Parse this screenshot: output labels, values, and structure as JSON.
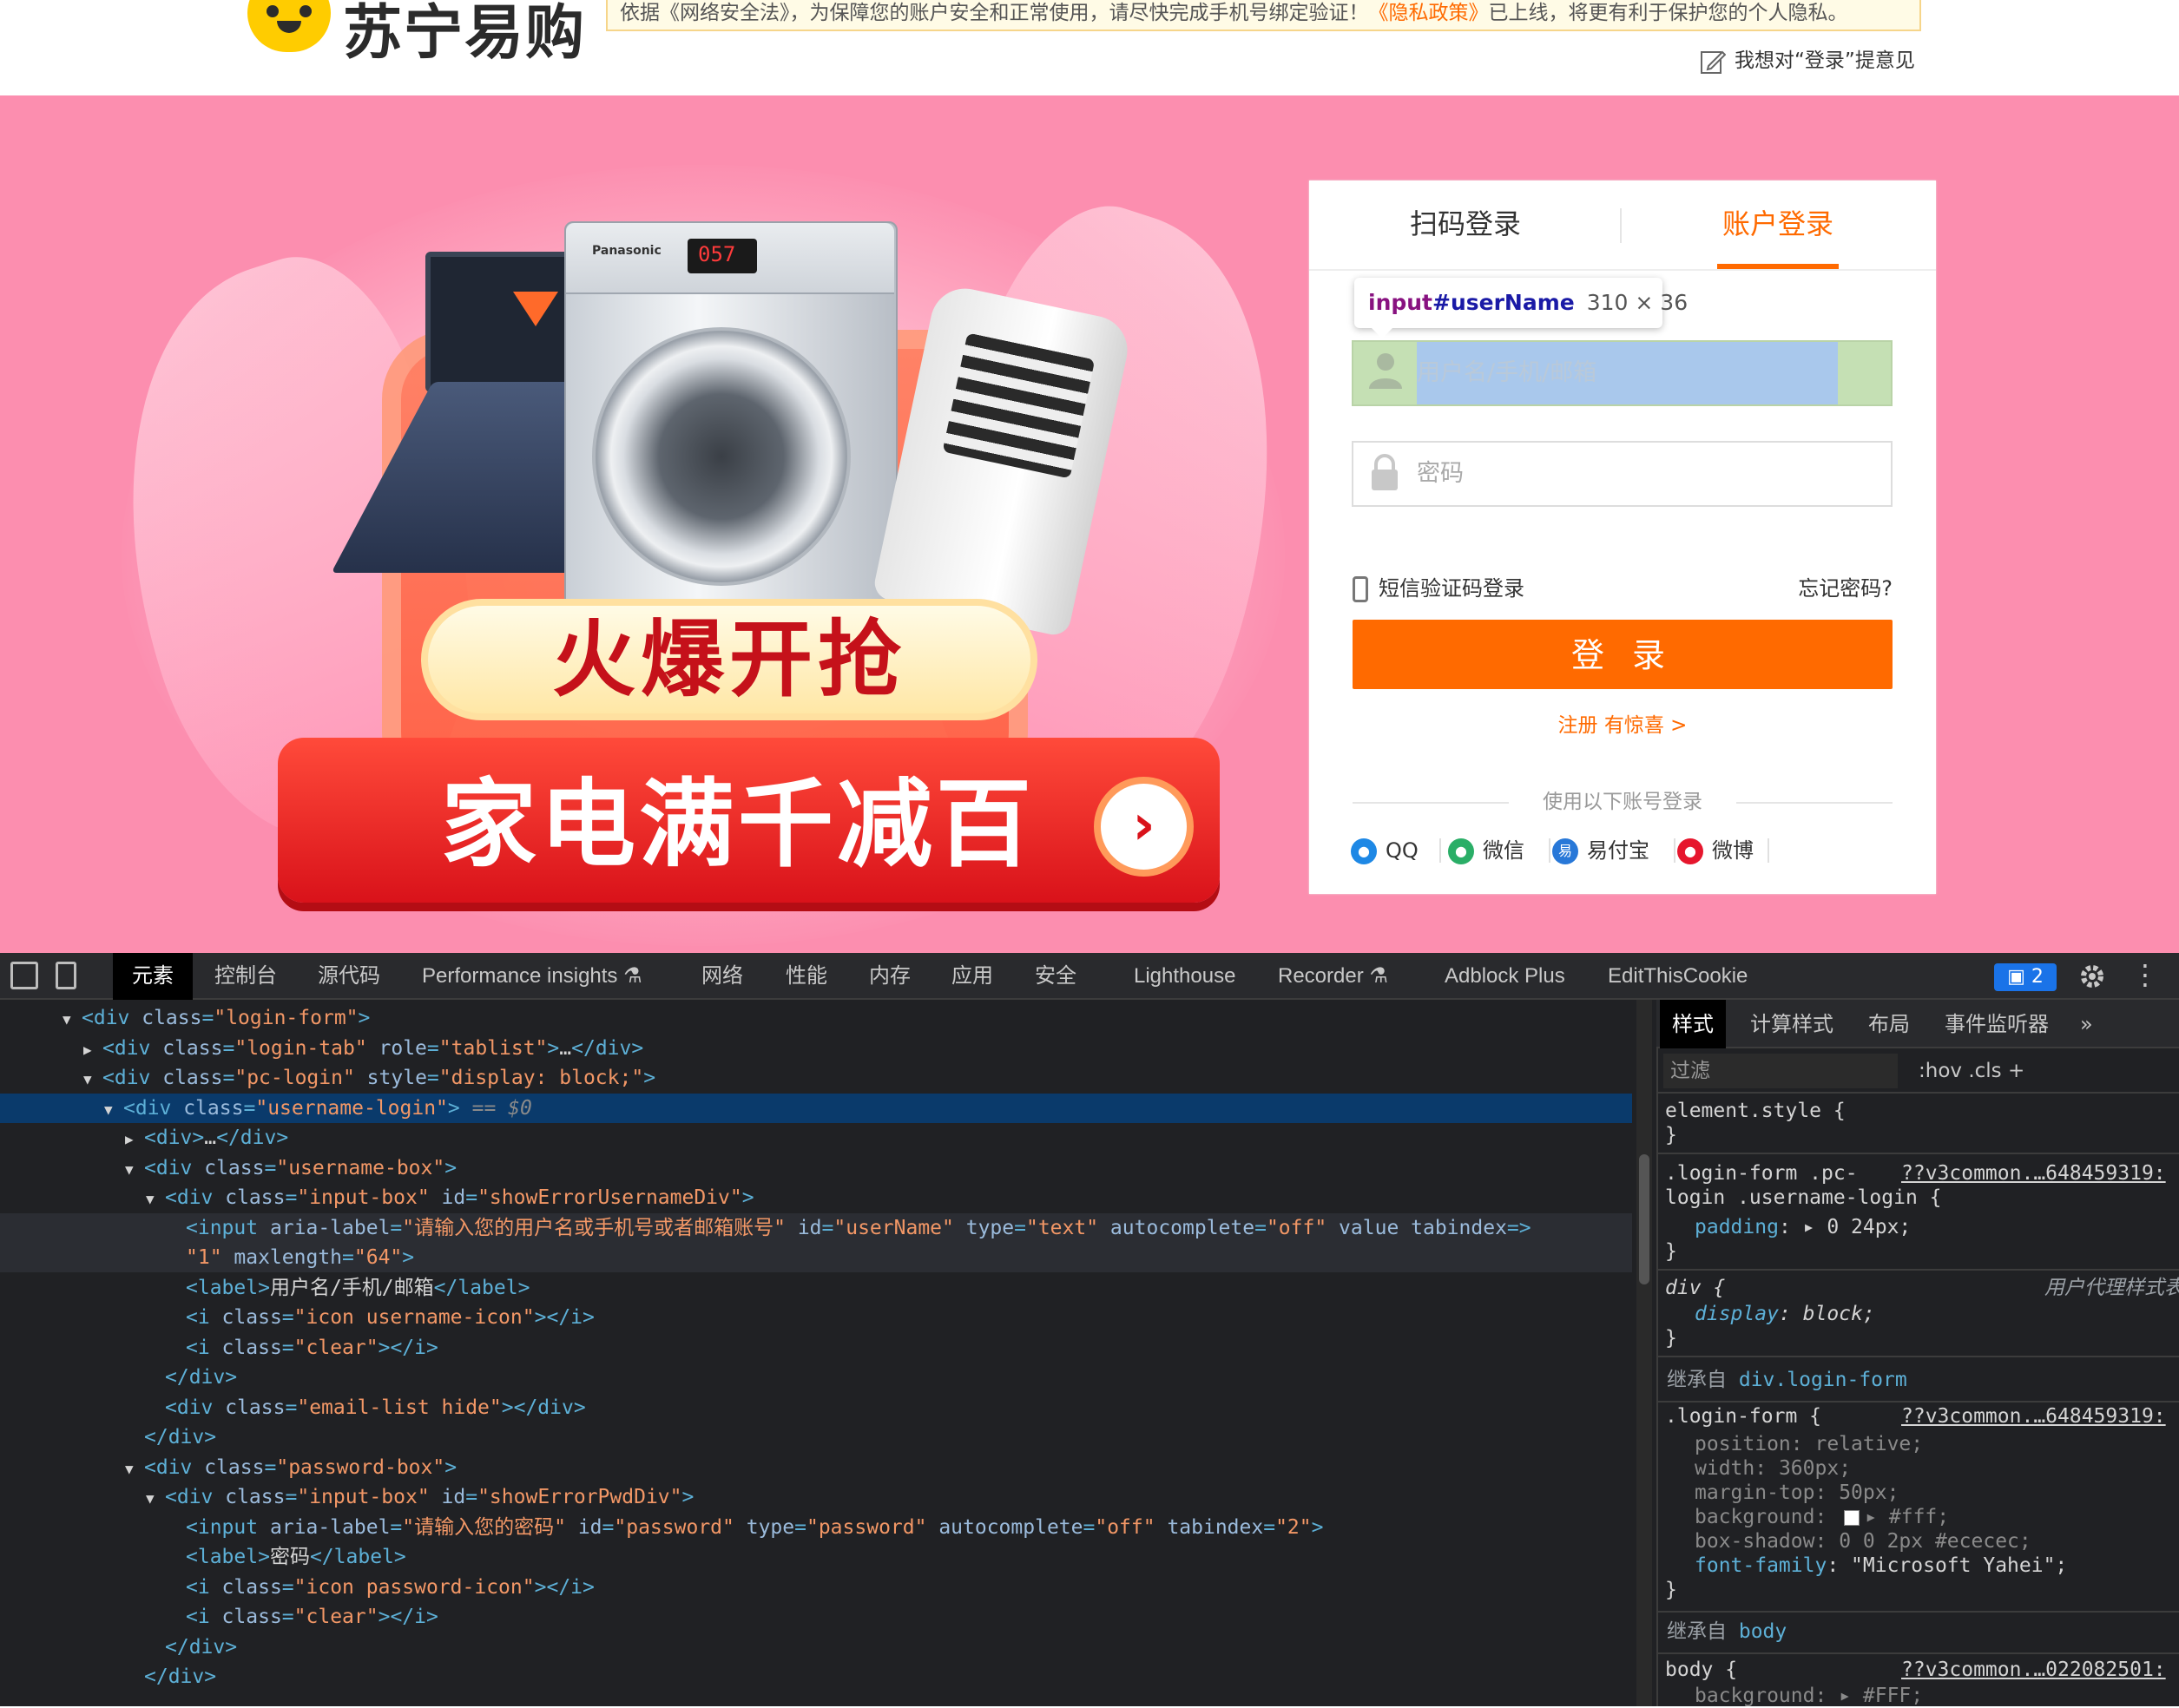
{
  "header": {
    "logo_text": "苏宁易购",
    "notice_prefix": "依据《网络安全法》，为保障您的账户安全和正常使用，请尽快完成手机号绑定验证！",
    "notice_link": "《隐私政策》",
    "notice_suffix": "已上线，将更有利于保护您的个人隐私。",
    "feedback": "我想对“登录”提意见"
  },
  "banner": {
    "slogan_top": "火爆开抢",
    "slogan_bottom": "家电满千减百",
    "washer_brand": "Panasonic"
  },
  "login": {
    "tab_qr": "扫码登录",
    "tab_account": "账户登录",
    "tooltip_tag": "input",
    "tooltip_id": "#userName",
    "tooltip_dim": "310 × 36",
    "username_placeholder": "用户名/手机/邮箱",
    "password_placeholder": "密码",
    "sms_login": "短信验证码登录",
    "forgot": "忘记密码?",
    "submit": "登 录",
    "register": "注册 有惊喜 >",
    "third_title": "使用以下账号登录",
    "third_party": [
      {
        "label": "QQ",
        "color": "#1e88e5"
      },
      {
        "label": "微信",
        "color": "#2aae67"
      },
      {
        "label": "易付宝",
        "color": "#2878d8"
      },
      {
        "label": "微博",
        "color": "#e6162d"
      }
    ]
  },
  "devtools": {
    "tabs": [
      "元素",
      "控制台",
      "源代码",
      "Performance insights",
      "网络",
      "性能",
      "内存",
      "应用",
      "安全",
      "Lighthouse",
      "Recorder",
      "Adblock Plus",
      "EditThisCookie"
    ],
    "issues_count": "2",
    "dom": [
      {
        "indent": 0,
        "tri": "▼",
        "html": "div",
        "attrs": [
          [
            "class",
            "login-form"
          ]
        ],
        "close": false
      },
      {
        "indent": 1,
        "tri": "▶",
        "html": "div",
        "attrs": [
          [
            "class",
            "login-tab"
          ],
          [
            "role",
            "tablist"
          ]
        ],
        "close": true,
        "inner": "…"
      },
      {
        "indent": 1,
        "tri": "▼",
        "html": "div",
        "attrs": [
          [
            "class",
            "pc-login"
          ],
          [
            "style",
            "display: block;"
          ]
        ],
        "close": false
      },
      {
        "indent": 2,
        "tri": "▼",
        "html": "div",
        "attrs": [
          [
            "class",
            "username-login"
          ]
        ],
        "close": false,
        "selected": true,
        "suffix": " == $0"
      },
      {
        "indent": 3,
        "tri": "▶",
        "html": "div",
        "attrs": [],
        "close": true,
        "inner": "…"
      },
      {
        "indent": 3,
        "tri": "▼",
        "html": "div",
        "attrs": [
          [
            "class",
            "username-box"
          ]
        ],
        "close": false
      },
      {
        "indent": 4,
        "tri": "▼",
        "html": "div",
        "attrs": [
          [
            "class",
            "input-box"
          ],
          [
            "id",
            "showErrorUsernameDiv"
          ]
        ],
        "close": false
      },
      {
        "indent": 5,
        "tri": "",
        "html": "input",
        "attrs": [
          [
            "aria-label",
            "请输入您的用户名或手机号或者邮箱账号"
          ],
          [
            "id",
            "userName"
          ],
          [
            "type",
            "text"
          ],
          [
            "autocomplete",
            "off"
          ],
          [
            "value",
            null
          ],
          [
            "tabindex",
            ""
          ]
        ],
        "close": false,
        "hovered": true
      },
      {
        "indent": 5,
        "tri": "",
        "raw": "\"1\" maxlength=\"64\">",
        "hovered": true
      },
      {
        "indent": 5,
        "tri": "",
        "html": "label",
        "attrs": [],
        "close": true,
        "inner": "用户名/手机/邮箱"
      },
      {
        "indent": 5,
        "tri": "",
        "html": "i",
        "attrs": [
          [
            "class",
            "icon username-icon"
          ]
        ],
        "close": true,
        "inner": ""
      },
      {
        "indent": 5,
        "tri": "",
        "html": "i",
        "attrs": [
          [
            "class",
            "clear"
          ]
        ],
        "close": true,
        "inner": ""
      },
      {
        "indent": 4,
        "tri": "",
        "end": "div"
      },
      {
        "indent": 4,
        "tri": "",
        "html": "div",
        "attrs": [
          [
            "class",
            "email-list hide"
          ]
        ],
        "close": true,
        "inner": ""
      },
      {
        "indent": 3,
        "tri": "",
        "end": "div"
      },
      {
        "indent": 3,
        "tri": "▼",
        "html": "div",
        "attrs": [
          [
            "class",
            "password-box"
          ]
        ],
        "close": false
      },
      {
        "indent": 4,
        "tri": "▼",
        "html": "div",
        "attrs": [
          [
            "class",
            "input-box"
          ],
          [
            "id",
            "showErrorPwdDiv"
          ]
        ],
        "close": false
      },
      {
        "indent": 5,
        "tri": "",
        "html": "input",
        "attrs": [
          [
            "aria-label",
            "请输入您的密码"
          ],
          [
            "id",
            "password"
          ],
          [
            "type",
            "password"
          ],
          [
            "autocomplete",
            "off"
          ],
          [
            "tabindex",
            "2"
          ]
        ],
        "close": false
      },
      {
        "indent": 5,
        "tri": "",
        "html": "label",
        "attrs": [],
        "close": true,
        "inner": "密码"
      },
      {
        "indent": 5,
        "tri": "",
        "html": "i",
        "attrs": [
          [
            "class",
            "icon password-icon"
          ]
        ],
        "close": true,
        "inner": ""
      },
      {
        "indent": 5,
        "tri": "",
        "html": "i",
        "attrs": [
          [
            "class",
            "clear"
          ]
        ],
        "close": true,
        "inner": ""
      },
      {
        "indent": 4,
        "tri": "",
        "end": "div"
      },
      {
        "indent": 3,
        "tri": "",
        "end": "div"
      }
    ],
    "styles_tabs": [
      "样式",
      "计算样式",
      "布局",
      "事件监听器",
      "»"
    ],
    "filter_placeholder": "过滤",
    "filter_tools": ":hov  .cls  +",
    "css": {
      "element_style": "element.style {",
      "close_brace": "}",
      "rule1_sel1": ".login-form .pc-",
      "rule1_sel2": "login .username-login {",
      "rule1_src": "??v3common.…648459319:",
      "rule1_prop": "padding",
      "rule1_val": "▸ 0 24px;",
      "rule2_sel": "div {",
      "rule2_src": "用户代理样式表",
      "rule2_prop": "display",
      "rule2_val": "block;",
      "inherit1": "继承自",
      "inherit1_sel": "div.login-form",
      "rule3_sel": ".login-form {",
      "rule3_src": "??v3common.…648459319:",
      "rule3_props": [
        [
          "position",
          "relative;"
        ],
        [
          "width",
          "360px;"
        ],
        [
          "margin-top",
          "50px;"
        ],
        [
          "background",
          "▸ #fff;"
        ],
        [
          "box-shadow",
          "0 0 2px #ececec;"
        ],
        [
          "font-family",
          "\"Microsoft Yahei\";"
        ]
      ],
      "inherit2": "继承自",
      "inherit2_sel": "body",
      "rule4_sel": "body {",
      "rule4_src": "??v3common.…022082501:",
      "rule4_prop": "background",
      "rule4_val": "▸ #FFF;"
    }
  }
}
